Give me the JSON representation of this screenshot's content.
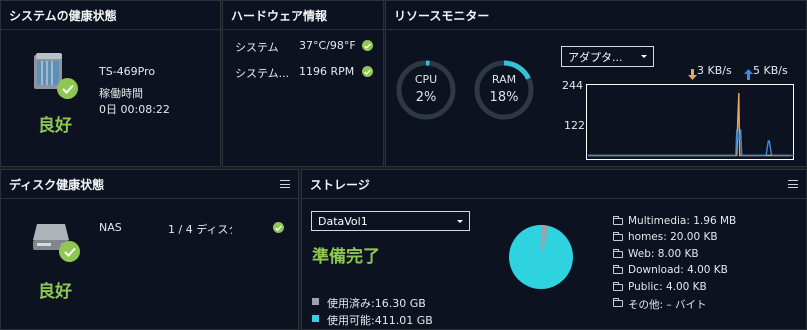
{
  "health": {
    "title": "システムの健康状態",
    "model": "TS-469Pro",
    "uptime_label": "稼働時間",
    "uptime": "0日 00:08:22",
    "status": "良好"
  },
  "hardware": {
    "title": "ハードウェア情報",
    "rows": [
      {
        "label": "システム",
        "value": "37°C/98°F"
      },
      {
        "label": "システム...",
        "value": "1196 RPM"
      }
    ]
  },
  "resource": {
    "title": "リソースモニター",
    "cpu": {
      "label": "CPU",
      "value": "2%",
      "percent": 2
    },
    "ram": {
      "label": "RAM",
      "value": "18%",
      "percent": 18
    },
    "adapter": "アダプタ...",
    "upload": "3 KB/s",
    "download": "5 KB/s",
    "y_max": "244",
    "y_mid": "122",
    "colors": {
      "upload": "#f0a35e",
      "download": "#3d8bdc"
    }
  },
  "chart_data": {
    "type": "line",
    "ylim": [
      0,
      244
    ],
    "yticks": [
      122,
      244
    ],
    "series": [
      {
        "name": "3 KB/s",
        "values": [
          5,
          5,
          5,
          5,
          5,
          5,
          5,
          5,
          5,
          5,
          5,
          5,
          5,
          5,
          5,
          5,
          5,
          5,
          5,
          5,
          5,
          5,
          5,
          5,
          5,
          5,
          5,
          5,
          5,
          5,
          5,
          5,
          5,
          5,
          5,
          5,
          5,
          5,
          5,
          5,
          5,
          5,
          5,
          5,
          5,
          5,
          5,
          5,
          5,
          5,
          5,
          5,
          5,
          5,
          5,
          5,
          5,
          5,
          5,
          5,
          5,
          5,
          5,
          5,
          5,
          5,
          5,
          5,
          5,
          5,
          5,
          5,
          5,
          5,
          5,
          5,
          5,
          5,
          5,
          5,
          5,
          5,
          5,
          5,
          5,
          5,
          5,
          5,
          5,
          5,
          5,
          5,
          5,
          5,
          5,
          5,
          5,
          5,
          5,
          5,
          5,
          5,
          5,
          5,
          5,
          5,
          5,
          5,
          5,
          5,
          5,
          5,
          5,
          5,
          5,
          5,
          5,
          5,
          5,
          5,
          5,
          5,
          5,
          5,
          5,
          5,
          5,
          5,
          5,
          5,
          5,
          5,
          5,
          5,
          5,
          5,
          5,
          5,
          5,
          5,
          5,
          5,
          5,
          5,
          5,
          5,
          5,
          5,
          5,
          5,
          5,
          5,
          5,
          5,
          5,
          5,
          5,
          5,
          5,
          5,
          5,
          5,
          5,
          5,
          5,
          5,
          5,
          5,
          5,
          5,
          5,
          5,
          5,
          5,
          5,
          5,
          5,
          5,
          5,
          5,
          5,
          5,
          5,
          5,
          5,
          5,
          5,
          5,
          5,
          5,
          5,
          5,
          5,
          5,
          5,
          5,
          5,
          5,
          5,
          5,
          5,
          5,
          5,
          5,
          5,
          5
        ]
      },
      {
        "name": "5 KB/s",
        "values": [
          5,
          5,
          5,
          5,
          5,
          5,
          5,
          5,
          5,
          5,
          5,
          5,
          5,
          5,
          5,
          5,
          5,
          5,
          5,
          5,
          5,
          5,
          5,
          5,
          5,
          5,
          5,
          5,
          5,
          5,
          5,
          5,
          5,
          5,
          5,
          5,
          5,
          5,
          5,
          5,
          5,
          5,
          5,
          5,
          5,
          5,
          5,
          5,
          5,
          5,
          5,
          5,
          5,
          5,
          5,
          5,
          5,
          5,
          5,
          5,
          5,
          5,
          5,
          5,
          5,
          5,
          5,
          5,
          5,
          5,
          5,
          5,
          5,
          5,
          5,
          5,
          5,
          5,
          5,
          5,
          5,
          5,
          5,
          5,
          5,
          5,
          5,
          5,
          5,
          5,
          5,
          5,
          5,
          5,
          5,
          5,
          5,
          5,
          5,
          5,
          5,
          5,
          5,
          5,
          5,
          5,
          5,
          5,
          5,
          5,
          5,
          5,
          5,
          5,
          5,
          5,
          5,
          5,
          5,
          5,
          5,
          5,
          5,
          5,
          5,
          5,
          5,
          5,
          5,
          5,
          5,
          5,
          5,
          5,
          5,
          5,
          5,
          5,
          5,
          5,
          5,
          5,
          5,
          5,
          5,
          5,
          5,
          5,
          5,
          5,
          5,
          5,
          5,
          5,
          5,
          5,
          5,
          5,
          5,
          5,
          5,
          5,
          5,
          5,
          5,
          5,
          5,
          5,
          5,
          5,
          5,
          5,
          5,
          5,
          5,
          5,
          5,
          5,
          5,
          5,
          5,
          5,
          5,
          5,
          5,
          5,
          5,
          5,
          5,
          5,
          5,
          5,
          5,
          5,
          5,
          5,
          5,
          5,
          5,
          5,
          5,
          5,
          5,
          5,
          5,
          5,
          5,
          5,
          5,
          5
        ]
      }
    ]
  },
  "disk": {
    "title": "ディスク健康状態",
    "name": "NAS",
    "info": "1 / 4 ディスク",
    "status": "良好"
  },
  "storage": {
    "title": "ストレージ",
    "volume": "DataVol1",
    "status": "準備完了",
    "used": "使用済み:16.30 GB",
    "free": "使用可能:411.01 GB",
    "used_fraction": 0.038,
    "colors": {
      "used": "#9ba3ab",
      "free": "#2fd3e0"
    },
    "folders": [
      "Multimedia: 1.96 MB",
      "homes: 20.00 KB",
      "Web: 8.00 KB",
      "Download: 4.00 KB",
      "Public: 4.00 KB",
      "その他: – バイト"
    ]
  }
}
